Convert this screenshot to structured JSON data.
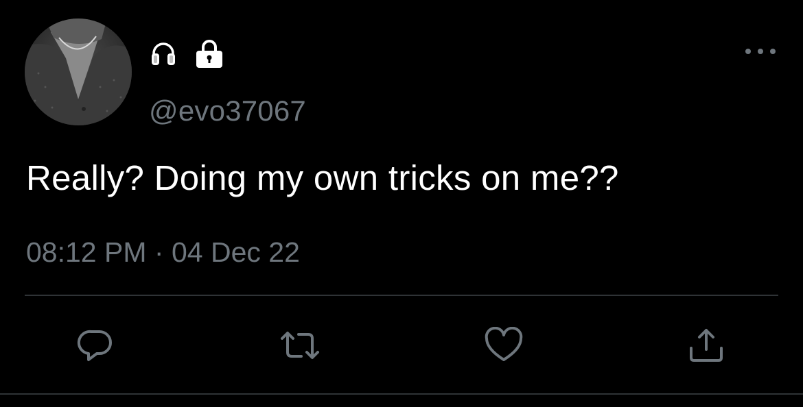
{
  "tweet": {
    "author": {
      "handle": "@evo37067",
      "avatar_icon": "profile-photo",
      "badges": [
        "headphones-icon",
        "lock-icon"
      ]
    },
    "text": "Really? Doing my own tricks on me??",
    "time": "08:12 PM",
    "separator": "·",
    "date": "04 Dec 22",
    "actions": [
      {
        "name": "reply",
        "icon": "reply-icon"
      },
      {
        "name": "retweet",
        "icon": "retweet-icon"
      },
      {
        "name": "like",
        "icon": "heart-icon"
      },
      {
        "name": "share",
        "icon": "share-icon"
      }
    ]
  },
  "colors": {
    "background": "#000000",
    "text": "#ffffff",
    "muted": "#6e767d",
    "divider": "#2f3336"
  }
}
